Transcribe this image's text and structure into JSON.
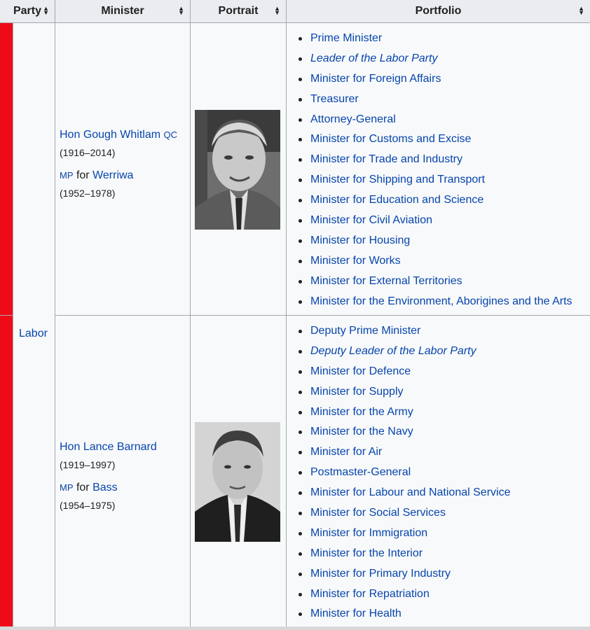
{
  "headers": {
    "party": "Party",
    "minister": "Minister",
    "portrait": "Portrait",
    "portfolio": "Portfolio"
  },
  "party": {
    "label": "Labor",
    "color": "#ee0a17"
  },
  "ministers": [
    {
      "title": "Hon",
      "name": "Gough Whitlam",
      "postnominal": "QC",
      "lifespan": "(1916–2014)",
      "mp": "MP",
      "for_word": "for",
      "seat": "Werriwa",
      "term": "(1952–1978)",
      "portfolios": [
        "Prime Minister",
        "Leader of the Labor Party",
        "Minister for Foreign Affairs",
        "Treasurer",
        "Attorney-General",
        "Minister for Customs and Excise",
        "Minister for Trade and Industry",
        "Minister for Shipping and Transport",
        "Minister for Education and Science",
        "Minister for Civil Aviation",
        "Minister for Housing",
        "Minister for Works",
        "Minister for External Territories",
        "Minister for the Environment, Aborigines and the Arts"
      ]
    },
    {
      "title": "Hon",
      "name": "Lance Barnard",
      "postnominal": "",
      "lifespan": "(1919–1997)",
      "mp": "MP",
      "for_word": "for",
      "seat": "Bass",
      "term": "(1954–1975)",
      "portfolios": [
        "Deputy Prime Minister",
        "Deputy Leader of the Labor Party",
        "Minister for Defence",
        "Minister for Supply",
        "Minister for the Army",
        "Minister for the Navy",
        "Minister for Air",
        "Postmaster-General",
        "Minister for Labour and National Service",
        "Minister for Social Services",
        "Minister for Immigration",
        "Minister for the Interior",
        "Minister for Primary Industry",
        "Minister for Repatriation",
        "Minister for Health"
      ]
    }
  ],
  "icons": {
    "sort": "sort-icon"
  }
}
